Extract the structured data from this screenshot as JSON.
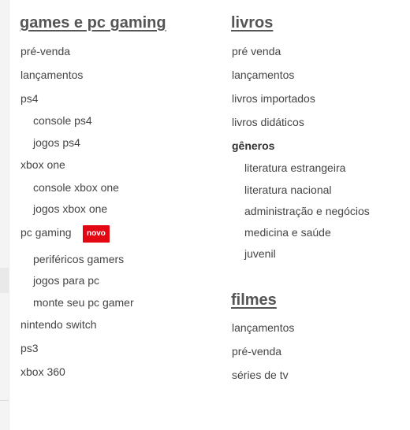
{
  "games": {
    "heading": "games e pc gaming",
    "items": [
      {
        "label": "pré-venda"
      },
      {
        "label": "lançamentos"
      },
      {
        "label": "ps4"
      },
      {
        "label": "console ps4"
      },
      {
        "label": "jogos ps4"
      },
      {
        "label": "xbox one"
      },
      {
        "label": "console xbox one"
      },
      {
        "label": "jogos xbox one"
      },
      {
        "label": "pc gaming",
        "badge": "novo"
      },
      {
        "label": "periféricos gamers"
      },
      {
        "label": "jogos para pc"
      },
      {
        "label": "monte seu pc gamer"
      },
      {
        "label": "nintendo switch"
      },
      {
        "label": "ps3"
      },
      {
        "label": "xbox 360"
      }
    ]
  },
  "livros": {
    "heading": "livros",
    "items": [
      {
        "label": "pré venda"
      },
      {
        "label": "lançamentos"
      },
      {
        "label": "livros importados"
      },
      {
        "label": "livros didáticos"
      },
      {
        "label": "gêneros"
      },
      {
        "label": "literatura estrangeira"
      },
      {
        "label": "literatura nacional"
      },
      {
        "label": "administração e negócios"
      },
      {
        "label": "medicina e saúde"
      },
      {
        "label": "juvenil"
      }
    ]
  },
  "filmes": {
    "heading": "filmes",
    "items": [
      {
        "label": "lançamentos"
      },
      {
        "label": "pré-venda"
      },
      {
        "label": "séries de tv"
      }
    ]
  },
  "colors": {
    "badge_bg": "#e30613",
    "heading_text": "#555555",
    "link_text": "#444444"
  }
}
